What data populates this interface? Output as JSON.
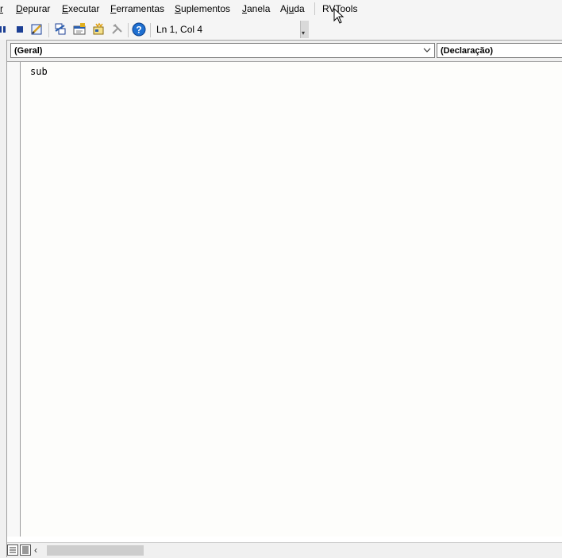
{
  "menu": {
    "items": [
      {
        "id": "exibir",
        "label_pre": "",
        "label_u": "r",
        "label_post": ""
      },
      {
        "id": "depurar",
        "label_pre": "",
        "label_u": "D",
        "label_post": "epurar"
      },
      {
        "id": "executar",
        "label_pre": "",
        "label_u": "E",
        "label_post": "xecutar"
      },
      {
        "id": "ferramentas",
        "label_pre": "",
        "label_u": "F",
        "label_post": "erramentas"
      },
      {
        "id": "suplementos",
        "label_pre": "",
        "label_u": "S",
        "label_post": "uplementos"
      },
      {
        "id": "janela",
        "label_pre": "",
        "label_u": "J",
        "label_post": "anela"
      },
      {
        "id": "ajuda",
        "label_pre": "Aj",
        "label_u": "u",
        "label_post": "da"
      },
      {
        "id": "rvtools",
        "label_pre": "RVTools",
        "label_u": "",
        "label_post": ""
      }
    ]
  },
  "toolbar": {
    "status": "Ln 1, Col 4",
    "icons": [
      "stop-icon",
      "design-mode-icon",
      "project-explorer-icon",
      "properties-icon",
      "object-browser-icon",
      "toolbox-icon",
      "help-icon"
    ]
  },
  "code_window": {
    "object_combo": "(Geral)",
    "procedure_combo": "(Declaração)",
    "lines": [
      "sub"
    ]
  },
  "colors": {
    "chrome": "#f0f0f0",
    "editor_bg": "#fdfdfb",
    "help_blue": "#1e6fd0"
  }
}
